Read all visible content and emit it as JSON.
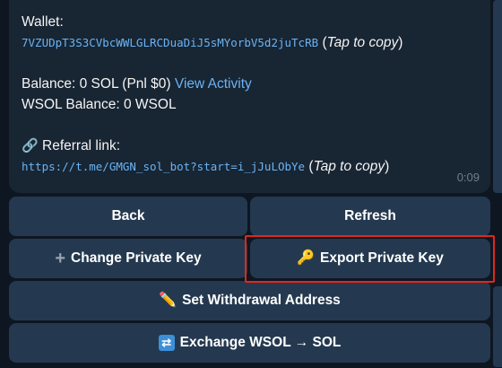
{
  "message": {
    "wallet_label": "Wallet:",
    "wallet_address": "7VZUDpT3S3CVbcWWLGLRCDuaDiJ5sMYorbV5d2juTcRB",
    "tap_to_copy": "Tap to copy",
    "balance_text": "Balance: 0 SOL (Pnl $0)",
    "view_activity": "View Activity",
    "wsol_balance": "WSOL Balance: 0 WSOL",
    "referral_label": "Referral link:",
    "referral_url": "https://t.me/GMGN_sol_bot?start=i_jJuLObYe",
    "time": "0:09"
  },
  "buttons": {
    "back": "Back",
    "refresh": "Refresh",
    "change_private_key": "Change Private Key",
    "export_private_key": "Export Private Key",
    "set_withdrawal_address": "Set Withdrawal Address",
    "exchange": "Exchange WSOL → SOL"
  },
  "icons": {
    "change_private_key": "plus-icon",
    "export_private_key": "key-icon",
    "set_withdrawal_address": "pencil-icon",
    "exchange": "shuffle-icon",
    "referral": "link-icon"
  },
  "colors": {
    "background": "#0e1621",
    "bubble": "#182533",
    "button": "#24394f",
    "link": "#6ab3f3",
    "highlight": "#e0281e"
  }
}
